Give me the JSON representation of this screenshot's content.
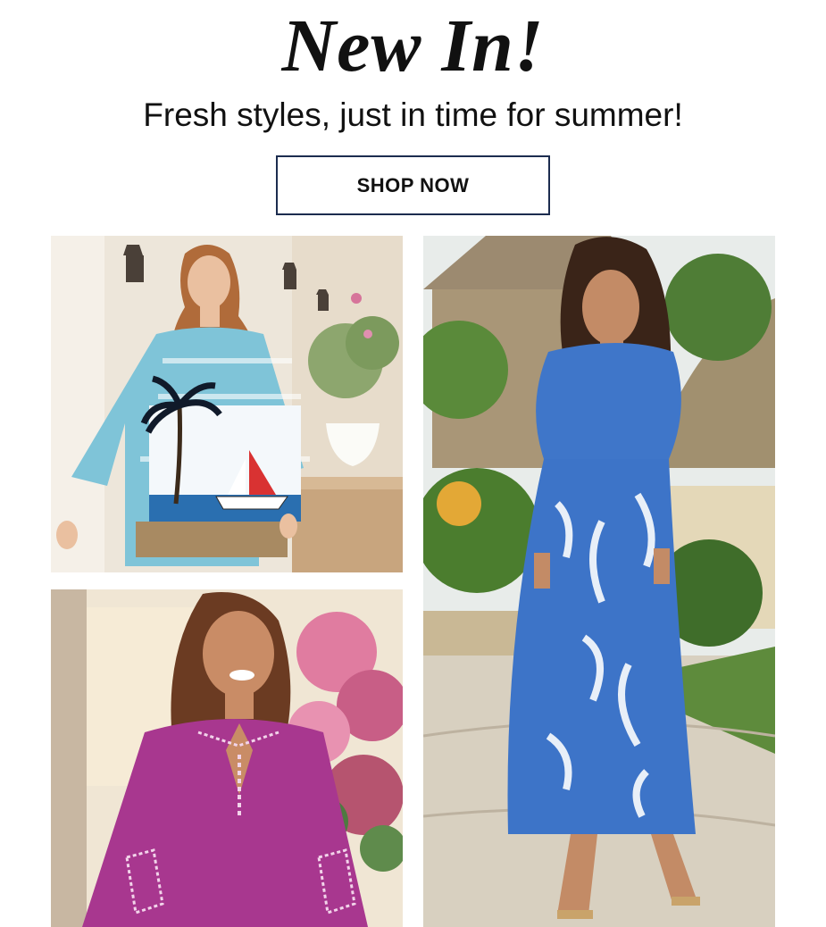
{
  "hero": {
    "title": "New In!",
    "subtitle": "Fresh styles, just in time for summer!",
    "cta_label": "SHOP NOW"
  },
  "products": [
    {
      "icon": "palm-tree-top-photo"
    },
    {
      "icon": "embroidered-tunic-photo"
    },
    {
      "icon": "floral-maxi-dress-photo"
    }
  ],
  "colors": {
    "button_border": "#1c2c4f",
    "text": "#111111"
  }
}
